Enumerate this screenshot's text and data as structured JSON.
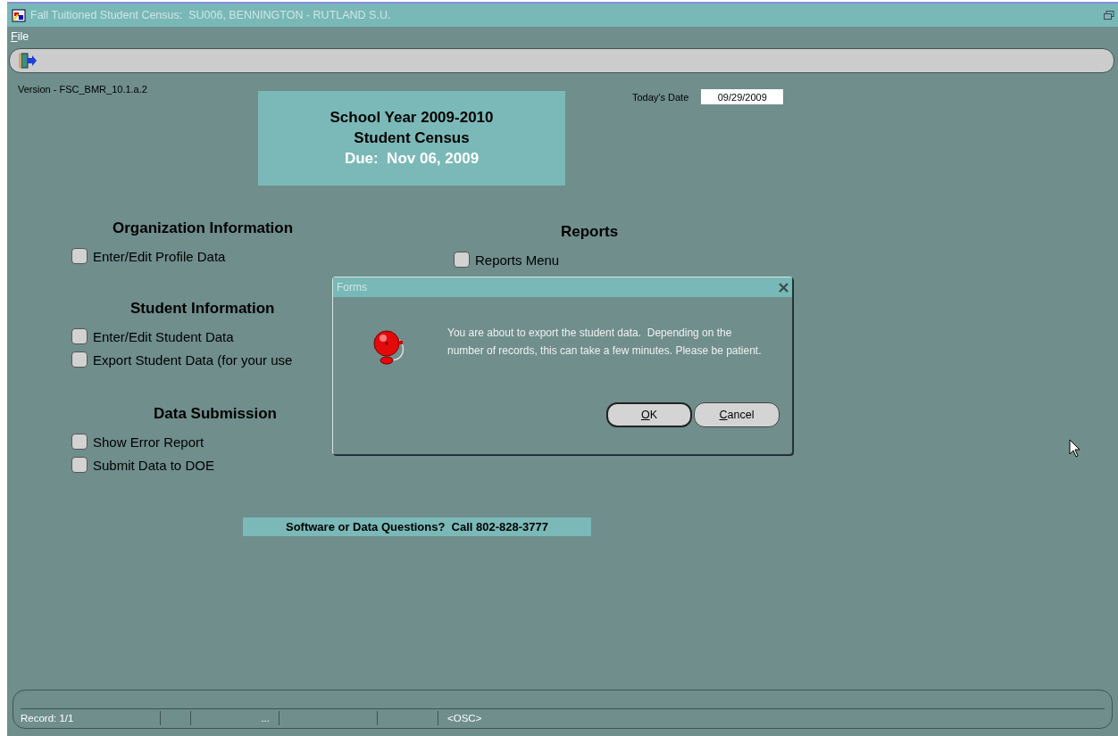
{
  "window": {
    "title": "Fall Tuitioned Student Census:  SU006, BENNINGTON - RUTLAND S.U."
  },
  "menu": [
    {
      "label": "File"
    }
  ],
  "version": "Version - FSC_BMR_10.1.a.2",
  "banner": {
    "lines": [
      "School Year 2009-2010",
      "Student Census",
      "Due:  Nov 06, 2009"
    ]
  },
  "date_field": {
    "label": "Today's Date",
    "value": "09/29/2009"
  },
  "sections": [
    {
      "heading": "Organization Information",
      "items": [
        "Enter/Edit Profile Data"
      ]
    },
    {
      "heading": "Reports",
      "items": [
        "Reports Menu"
      ]
    },
    {
      "heading": "Student Information",
      "items": [
        "Enter/Edit Student Data",
        "Export Student Data (for your use"
      ]
    },
    {
      "heading": "Data Submission",
      "items": [
        "Show Error Report",
        "Submit Data to DOE"
      ]
    }
  ],
  "help_bar": "Software or Data Questions?  Call 802-828-3777",
  "dialog": {
    "title": "Forms",
    "message": "You are about to export the student data.  Depending on the number of records, this can take a few minutes. Please be patient.",
    "buttons": [
      {
        "label": "OK",
        "default": true
      },
      {
        "label": "Cancel",
        "default": false
      }
    ]
  },
  "status_bar": {
    "record": "Record: 1/1",
    "field_3": "...",
    "mode": "<OSC>"
  }
}
